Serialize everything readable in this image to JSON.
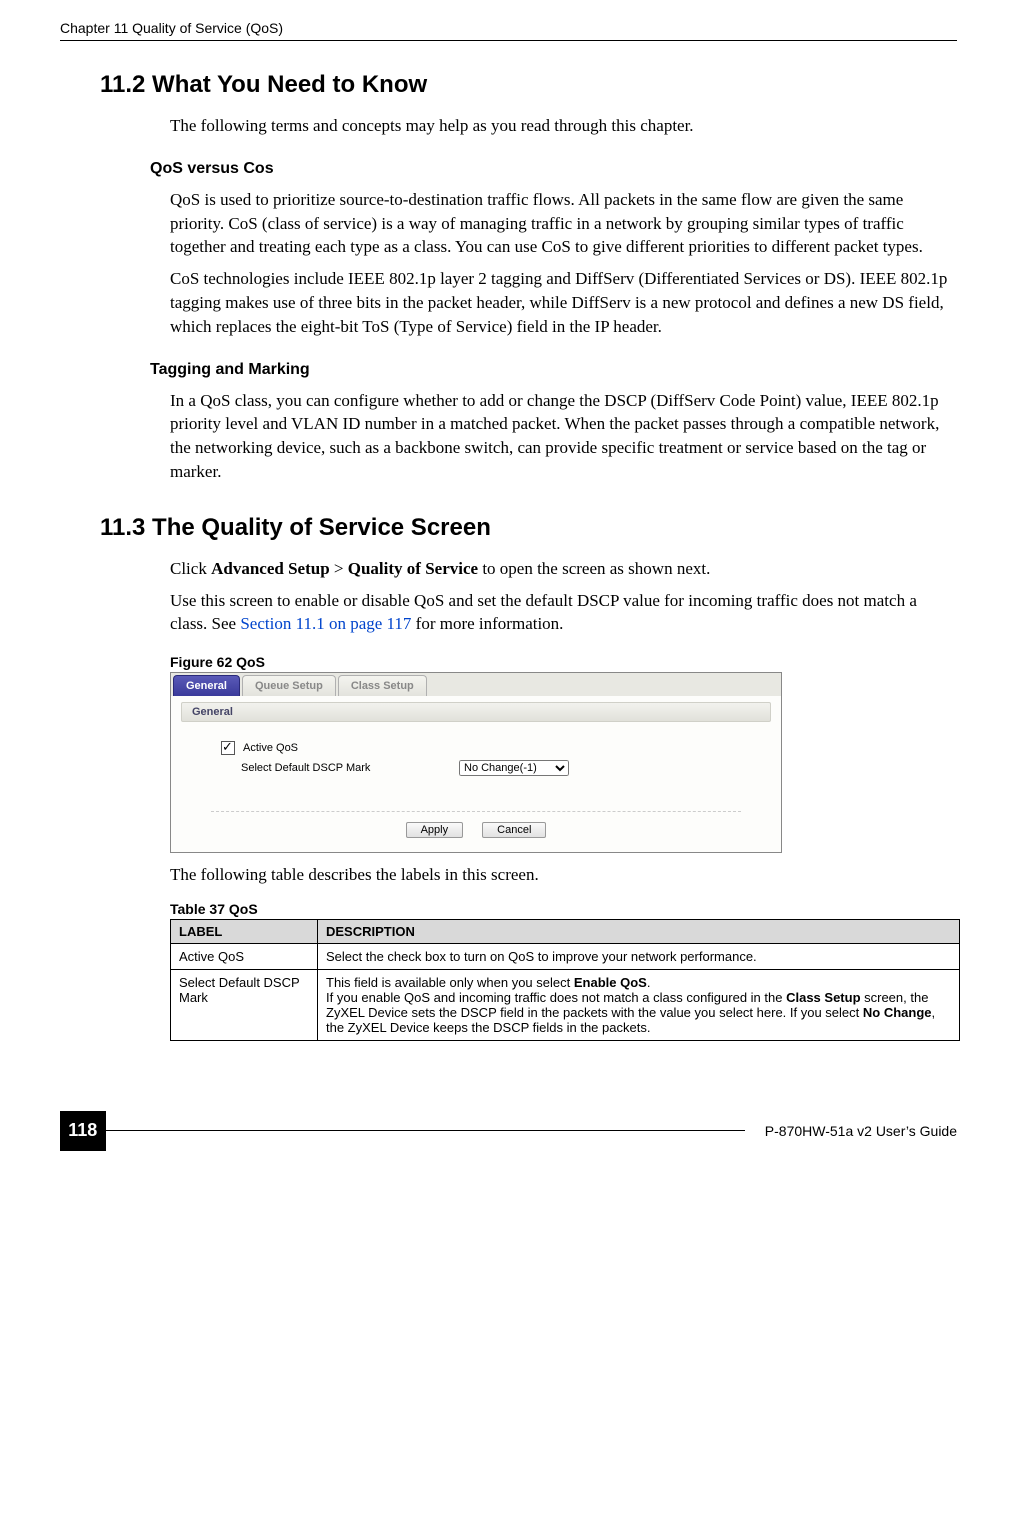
{
  "header": {
    "chapter": "Chapter 11 Quality of Service (QoS)"
  },
  "section_11_2": {
    "title": "11.2  What You Need to Know",
    "intro": "The following terms and concepts may help as you read through this chapter.",
    "qos_vs_cos": {
      "heading": "QoS versus Cos",
      "p1": "QoS is used to prioritize source-to-destination traffic flows. All packets in the same flow are given the same priority. CoS (class of service) is a way of managing traffic in a network by grouping similar types of traffic together and treating each type as a class. You can use CoS to give different priorities to different packet types.",
      "p2": "CoS technologies include IEEE 802.1p layer 2 tagging and DiffServ (Differentiated Services or DS). IEEE 802.1p tagging makes use of three bits in the packet header, while DiffServ is a new protocol and defines a new DS field, which replaces the eight-bit ToS (Type of Service) field in the IP header."
    },
    "tagging": {
      "heading": "Tagging and Marking",
      "p1": "In a QoS class, you can configure whether to add or change the DSCP (DiffServ Code Point) value, IEEE 802.1p priority level and VLAN ID number in a matched packet. When the packet passes through a compatible network, the networking device, such as a backbone switch, can provide specific treatment or service based on the tag or marker."
    }
  },
  "section_11_3": {
    "title": "11.3  The Quality of Service Screen",
    "click_prefix": "Click ",
    "click_path1": "Advanced Setup",
    "click_gt": " > ",
    "click_path2": "Quality of Service",
    "click_suffix": " to open the screen as shown next.",
    "p2a": "Use this screen to enable or disable QoS and set the default DSCP value for incoming traffic does not match a class. See ",
    "p2_link": "Section 11.1 on page 117",
    "p2b": " for more information."
  },
  "figure": {
    "caption": "Figure 62   QoS",
    "tabs": {
      "general": "General",
      "queue": "Queue Setup",
      "class": "Class Setup"
    },
    "panel_title": "General",
    "active_qos_label": "Active QoS",
    "dscp_label": "Select Default DSCP Mark",
    "dscp_value": "No Change(-1)",
    "apply": "Apply",
    "cancel": "Cancel"
  },
  "table_intro": "The following table describes the labels in this screen.",
  "table": {
    "caption": "Table 37   QoS",
    "col1": "LABEL",
    "col2": "DESCRIPTION",
    "rows": [
      {
        "label": "Active QoS",
        "desc": "Select the check box to turn on QoS to improve your network performance."
      },
      {
        "label": "Select Default DSCP Mark",
        "desc_line1a": "This field is available only when you select ",
        "desc_line1b": "Enable QoS",
        "desc_line1c": ".",
        "desc_line2a": "If you enable QoS and incoming traffic does not match a class configured in the ",
        "desc_line2b": "Class Setup",
        "desc_line2c": " screen, the ZyXEL Device sets the DSCP field in the packets with the value you select here. If you select ",
        "desc_line2d": "No Change",
        "desc_line2e": ", the ZyXEL Device keeps the DSCP fields in the packets."
      }
    ]
  },
  "footer": {
    "page": "118",
    "guide": "P-870HW-51a v2 User’s Guide"
  }
}
